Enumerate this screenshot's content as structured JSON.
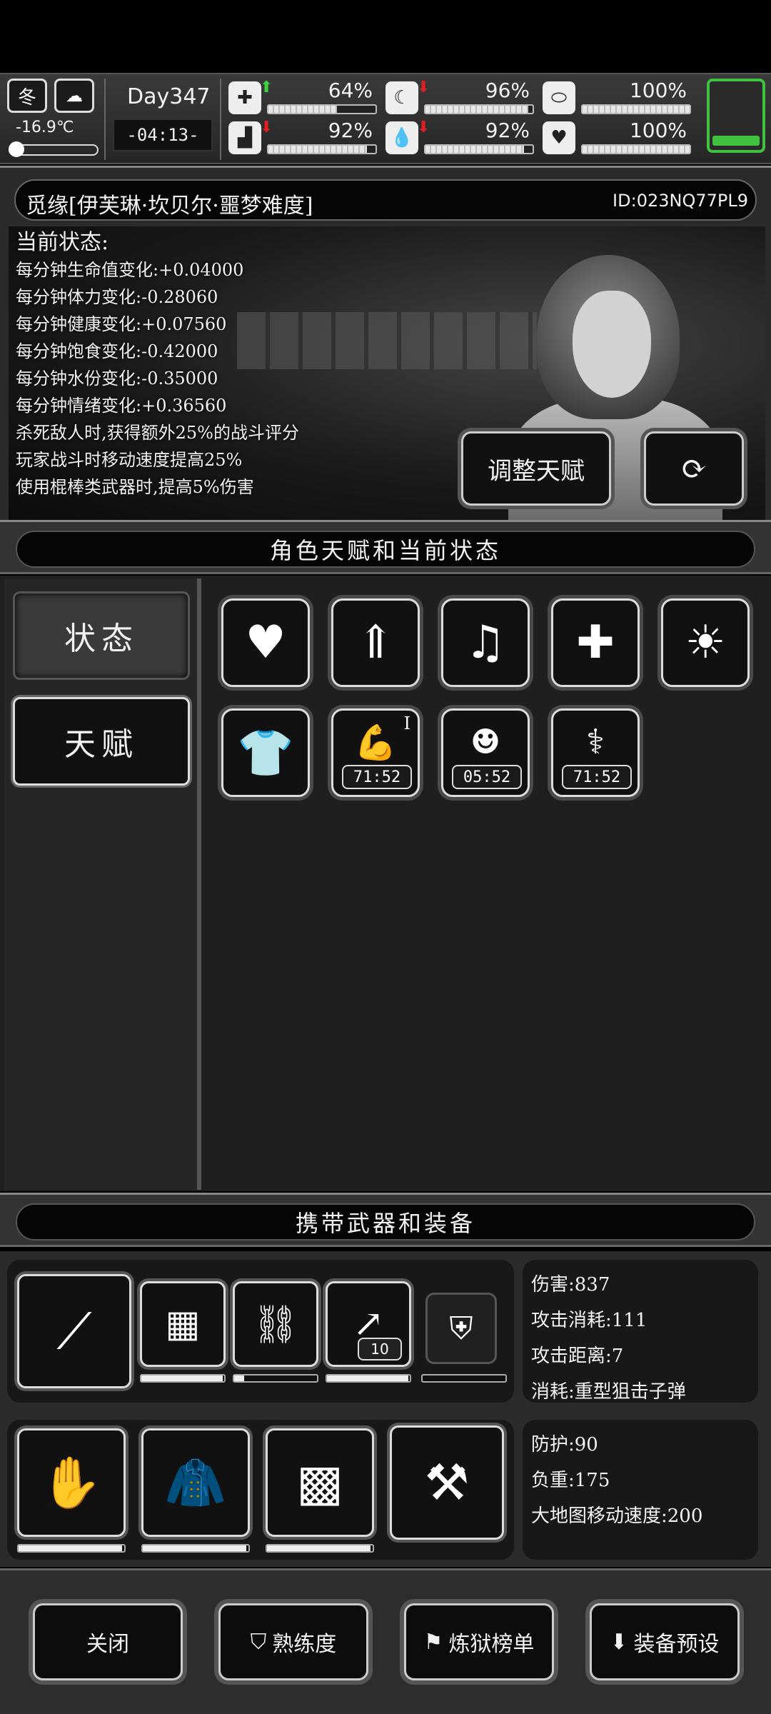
{
  "header": {
    "season": "冬",
    "temperature": "-16.9℃",
    "day": "Day347",
    "time": "-04:13-",
    "stats": [
      {
        "name": "health",
        "icon": "medkit-icon",
        "trend": "up",
        "percent": "64%",
        "value": 0.64
      },
      {
        "name": "satiety",
        "icon": "stomach-icon",
        "trend": "down",
        "percent": "96%",
        "value": 0.96
      },
      {
        "name": "immunity",
        "icon": "pill-icon",
        "trend": "none",
        "percent": "100%",
        "value": 1.0
      },
      {
        "name": "stamina",
        "icon": "boot-icon",
        "trend": "down",
        "percent": "92%",
        "value": 0.92
      },
      {
        "name": "hydration",
        "icon": "water-drop-icon",
        "trend": "down",
        "percent": "92%",
        "value": 0.92
      },
      {
        "name": "mood",
        "icon": "heart-icon",
        "trend": "none",
        "percent": "100%",
        "value": 1.0
      }
    ]
  },
  "character": {
    "name": "觅缘[伊芙琳·坎贝尔·噩梦难度]",
    "id": "ID:023NQ77PL9",
    "status_heading": "当前状态:",
    "status_lines": [
      "每分钟生命值变化:+0.04000",
      "每分钟体力变化:-0.28060",
      "每分钟健康变化:+0.07560",
      "每分钟饱食变化:-0.42000",
      "每分钟水份变化:-0.35000",
      "每分钟情绪变化:+0.36560",
      "杀死敌人时,获得额外25%的战斗评分",
      "玩家战斗时移动速度提高25%",
      "使用棍棒类武器时,提高5%伤害"
    ],
    "adjust_button": "调整天赋"
  },
  "talent_section": {
    "title": "角色天赋和当前状态",
    "tabs": [
      "状态",
      "天赋"
    ],
    "icons": [
      {
        "name": "heart-icon",
        "glyph": "♥",
        "timer": ""
      },
      {
        "name": "stomach-up-icon",
        "glyph": "⇑",
        "timer": ""
      },
      {
        "name": "music-heart-icon",
        "glyph": "♫",
        "timer": ""
      },
      {
        "name": "clipboard-pill-icon",
        "glyph": "✚",
        "timer": ""
      },
      {
        "name": "alarm-light-icon",
        "glyph": "☀",
        "timer": ""
      },
      {
        "name": "shirt-icon",
        "glyph": "👕",
        "timer": ""
      },
      {
        "name": "flexed-arm-icon",
        "glyph": "💪",
        "timer": "71:52",
        "mark": "I"
      },
      {
        "name": "zombie-face-icon",
        "glyph": "☻",
        "timer": "05:52"
      },
      {
        "name": "dna-icon",
        "glyph": "⚕",
        "timer": "71:52"
      }
    ]
  },
  "equipment_section": {
    "title": "携带武器和装备",
    "weapon_stats": [
      "伤害:837",
      "攻击消耗:111",
      "攻击距离:7",
      "消耗:重型狙击子弹"
    ],
    "armor_stats": [
      "防护:90",
      "负重:175",
      "大地图移动速度:200"
    ],
    "weapon_slots": [
      {
        "name": "sniper-rifle-icon",
        "durability": null
      },
      {
        "name": "net-icon",
        "durability": 0.98
      },
      {
        "name": "chain-icon",
        "durability": 0.12
      },
      {
        "name": "spear-icon",
        "durability": 0.98,
        "count": "10"
      },
      {
        "name": "riot-shield-icon",
        "durability": 0.0
      }
    ],
    "armor_slots": [
      {
        "name": "fur-gloves-icon",
        "durability": 0.98
      },
      {
        "name": "fur-coat-icon",
        "durability": 0.98
      },
      {
        "name": "fur-pants-icon",
        "durability": 0.98
      },
      {
        "name": "backpack-icon",
        "durability": null
      }
    ]
  },
  "bottom_buttons": [
    {
      "label": "关闭",
      "icon": ""
    },
    {
      "label": "熟练度",
      "icon": "skill-shield-icon"
    },
    {
      "label": "炼狱榜单",
      "icon": "banner-icon"
    },
    {
      "label": "装备预设",
      "icon": "preset-box-icon"
    }
  ],
  "colors": {
    "accent_green": "#3fc33f",
    "trend_up": "#3cd23c",
    "trend_down": "#e02020"
  }
}
